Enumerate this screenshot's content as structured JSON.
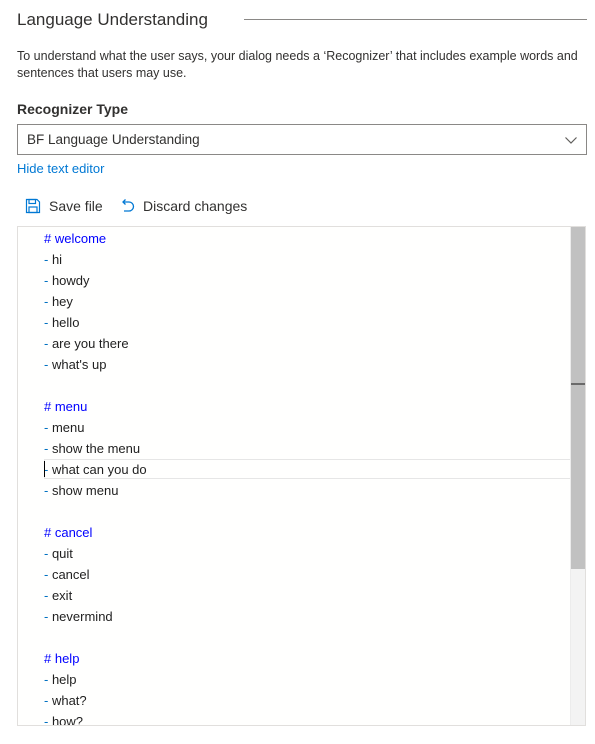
{
  "section": {
    "title": "Language Understanding",
    "description": "To understand what the user says, your dialog needs a ‘Recognizer’ that includes example words and sentences that users may use."
  },
  "recognizer": {
    "label": "Recognizer Type",
    "selected": "BF Language Understanding"
  },
  "links": {
    "hide_text_editor": "Hide text editor"
  },
  "toolbar": {
    "save_label": "Save file",
    "discard_label": "Discard changes"
  },
  "editor": {
    "lines": [
      {
        "type": "heading",
        "text": "# welcome"
      },
      {
        "type": "item",
        "text": "hi"
      },
      {
        "type": "item",
        "text": "howdy"
      },
      {
        "type": "item",
        "text": "hey"
      },
      {
        "type": "item",
        "text": "hello"
      },
      {
        "type": "item",
        "text": "are you there"
      },
      {
        "type": "item",
        "text": "what's up"
      },
      {
        "type": "blank",
        "text": ""
      },
      {
        "type": "heading",
        "text": "# menu"
      },
      {
        "type": "item",
        "text": "menu"
      },
      {
        "type": "item",
        "text": "show the menu"
      },
      {
        "type": "item",
        "text": "what can you do"
      },
      {
        "type": "item",
        "text": "show menu"
      },
      {
        "type": "blank",
        "text": ""
      },
      {
        "type": "heading",
        "text": "# cancel"
      },
      {
        "type": "item",
        "text": "quit"
      },
      {
        "type": "item",
        "text": "cancel"
      },
      {
        "type": "item",
        "text": "exit"
      },
      {
        "type": "item",
        "text": "nevermind"
      },
      {
        "type": "blank",
        "text": ""
      },
      {
        "type": "heading",
        "text": "# help"
      },
      {
        "type": "item",
        "text": "help"
      },
      {
        "type": "item",
        "text": "what?"
      },
      {
        "type": "item",
        "text": "how?"
      }
    ]
  },
  "colors": {
    "accent": "#0078d4",
    "heading": "#0000ff",
    "dash": "#0070c1"
  }
}
